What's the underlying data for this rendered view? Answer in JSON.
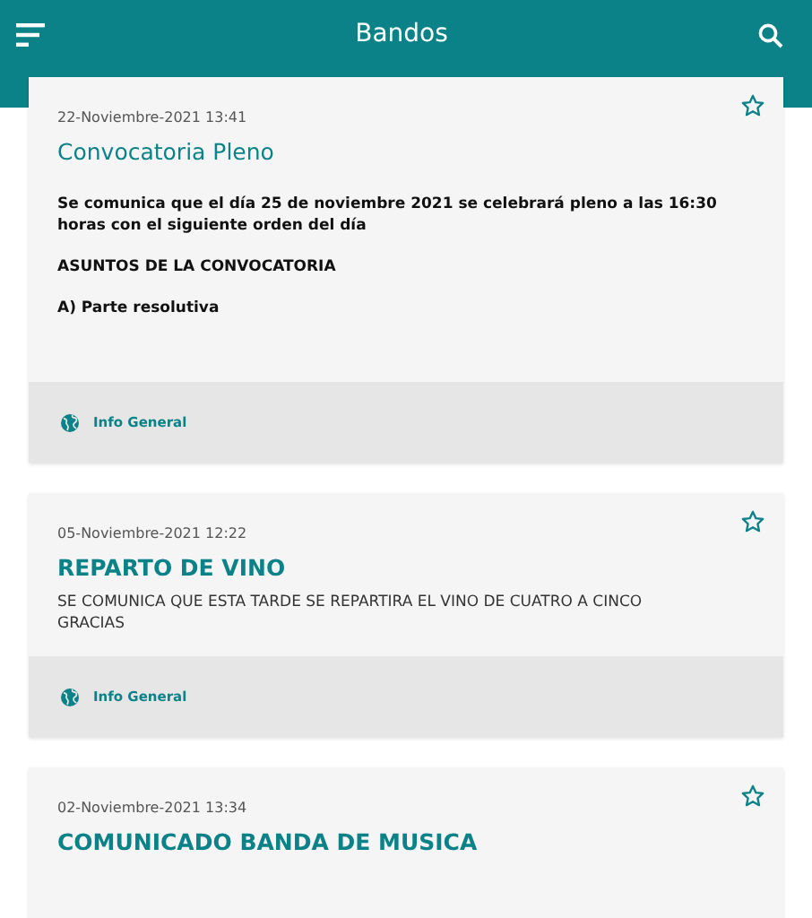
{
  "app_bar": {
    "title": "Bandos"
  },
  "cards": [
    {
      "date": "22-Noviembre-2021 13:41",
      "title": "Convocatoria Pleno",
      "favorite": false,
      "kind": "rich",
      "paragraphs": [
        "Se comunica que el día 25 de noviembre 2021 se celebrará pleno a las 16:30 horas con el siguiente orden del día",
        "ASUNTOS DE LA CONVOCATORIA",
        "A) Parte resolutiva"
      ],
      "category": "Info General"
    },
    {
      "date": "05-Noviembre-2021 12:22",
      "title": "REPARTO DE VINO",
      "favorite": false,
      "kind": "plain",
      "paragraphs": [
        "SE COMUNICA QUE ESTA TARDE SE REPARTIRA EL VINO DE CUATRO A CINCO GRACIAS"
      ],
      "category": "Info General"
    },
    {
      "date": "02-Noviembre-2021 13:34",
      "title": "COMUNICADO BANDA DE MUSICA",
      "favorite": false,
      "kind": "plain"
    }
  ]
}
